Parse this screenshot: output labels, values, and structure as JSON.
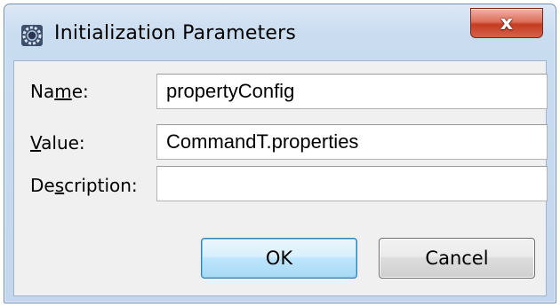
{
  "window": {
    "title": "Initialization Parameters",
    "close_glyph": "x"
  },
  "form": {
    "name": {
      "label_pre": "Na",
      "label_mnemonic": "m",
      "label_post": "e:",
      "value": "propertyConfig"
    },
    "value": {
      "label_pre": "",
      "label_mnemonic": "V",
      "label_post": "alue:",
      "value": "CommandT.properties"
    },
    "description": {
      "label_pre": "De",
      "label_mnemonic": "s",
      "label_post": "cription:",
      "value": ""
    }
  },
  "buttons": {
    "ok_label": "OK",
    "cancel_label": "Cancel"
  },
  "colors": {
    "ok_border": "#3c7fb1",
    "close_red": "#c43c22",
    "frame_blue": "#c3d6ec"
  },
  "icons": {
    "app": "eclipse-gear-icon",
    "close": "close-icon"
  }
}
